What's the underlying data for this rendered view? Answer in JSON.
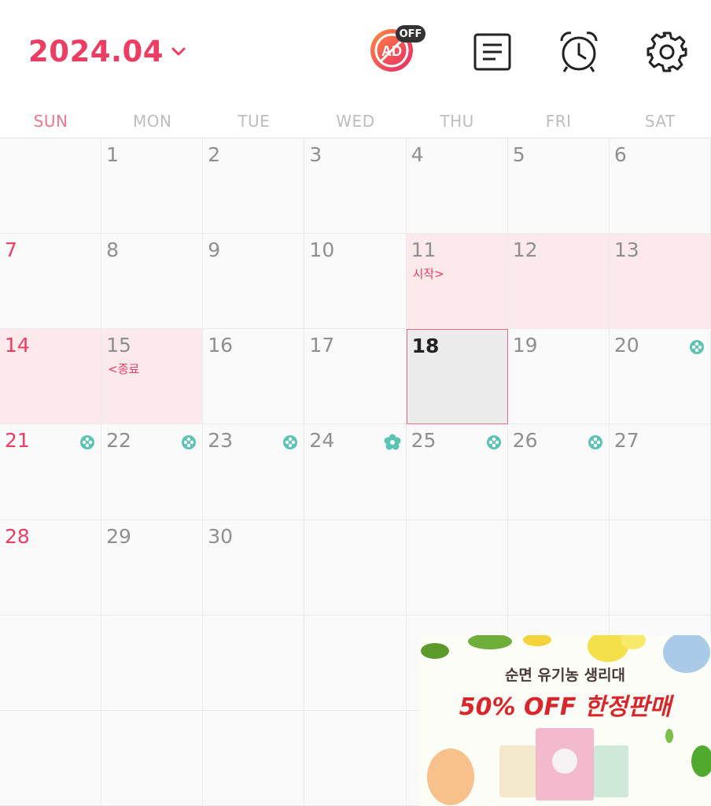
{
  "header": {
    "month": "2024.04",
    "ad_badge": "AD",
    "ad_off": "OFF"
  },
  "weekdays": [
    "SUN",
    "MON",
    "TUE",
    "WED",
    "THU",
    "FRI",
    "SAT"
  ],
  "days": [
    {
      "d": "",
      "row": 0,
      "col": 0
    },
    {
      "d": "1",
      "row": 0,
      "col": 1
    },
    {
      "d": "2",
      "row": 0,
      "col": 2
    },
    {
      "d": "3",
      "row": 0,
      "col": 3
    },
    {
      "d": "4",
      "row": 0,
      "col": 4
    },
    {
      "d": "5",
      "row": 0,
      "col": 5
    },
    {
      "d": "6",
      "row": 0,
      "col": 6
    },
    {
      "d": "7",
      "row": 1,
      "col": 0
    },
    {
      "d": "8",
      "row": 1,
      "col": 1
    },
    {
      "d": "9",
      "row": 1,
      "col": 2
    },
    {
      "d": "10",
      "row": 1,
      "col": 3
    },
    {
      "d": "11",
      "row": 1,
      "col": 4,
      "period": true,
      "note": "시작>"
    },
    {
      "d": "12",
      "row": 1,
      "col": 5,
      "period": true
    },
    {
      "d": "13",
      "row": 1,
      "col": 6,
      "period": true
    },
    {
      "d": "14",
      "row": 2,
      "col": 0,
      "period": true
    },
    {
      "d": "15",
      "row": 2,
      "col": 1,
      "period": true,
      "note": "<종료"
    },
    {
      "d": "16",
      "row": 2,
      "col": 2
    },
    {
      "d": "17",
      "row": 2,
      "col": 3
    },
    {
      "d": "18",
      "row": 2,
      "col": 4,
      "today": true
    },
    {
      "d": "19",
      "row": 2,
      "col": 5
    },
    {
      "d": "20",
      "row": 2,
      "col": 6,
      "fertile": "dot"
    },
    {
      "d": "21",
      "row": 3,
      "col": 0,
      "fertile": "dot"
    },
    {
      "d": "22",
      "row": 3,
      "col": 1,
      "fertile": "dot"
    },
    {
      "d": "23",
      "row": 3,
      "col": 2,
      "fertile": "dot"
    },
    {
      "d": "24",
      "row": 3,
      "col": 3,
      "fertile": "ovulation"
    },
    {
      "d": "25",
      "row": 3,
      "col": 4,
      "fertile": "dot"
    },
    {
      "d": "26",
      "row": 3,
      "col": 5,
      "fertile": "dot"
    },
    {
      "d": "27",
      "row": 3,
      "col": 6
    },
    {
      "d": "28",
      "row": 4,
      "col": 0
    },
    {
      "d": "29",
      "row": 4,
      "col": 1
    },
    {
      "d": "30",
      "row": 4,
      "col": 2
    }
  ],
  "banner": {
    "subtitle": "순면 유기농 생리대",
    "headline": "50% OFF 한정판매"
  },
  "colors": {
    "accent": "#ee3d62",
    "fertile": "#5bc4b5",
    "period_bg": "#fbe9ec"
  }
}
